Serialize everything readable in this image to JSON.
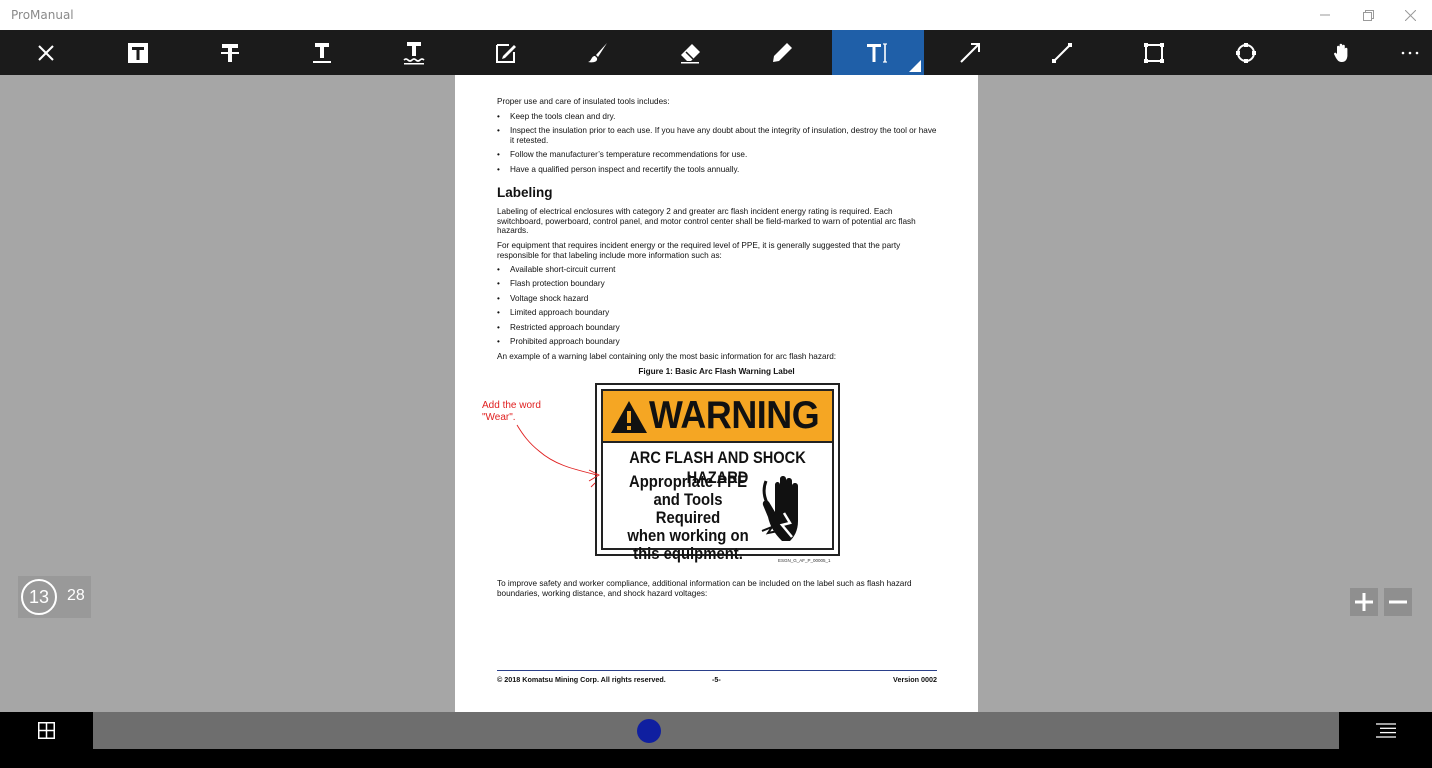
{
  "window": {
    "title": "ProManual",
    "controls": [
      "minimize-icon",
      "restore-icon",
      "close-icon"
    ]
  },
  "toolbar": {
    "tools": [
      {
        "name": "close-icon"
      },
      {
        "name": "highlight-text-icon"
      },
      {
        "name": "strikethrough-text-icon"
      },
      {
        "name": "underline-text-icon"
      },
      {
        "name": "squiggly-underline-icon"
      },
      {
        "name": "note-icon"
      },
      {
        "name": "brush-icon"
      },
      {
        "name": "eraser-icon"
      },
      {
        "name": "pencil-icon"
      },
      {
        "name": "text-box-icon",
        "active": true
      },
      {
        "name": "arrow-icon"
      },
      {
        "name": "line-icon"
      },
      {
        "name": "rectangle-icon"
      },
      {
        "name": "ellipse-icon"
      },
      {
        "name": "hand-pan-icon"
      },
      {
        "name": "more-icon"
      }
    ],
    "active_color": "#1f5fa8"
  },
  "document": {
    "intro": "Proper use and care of insulated tools includes:",
    "care_bullets": [
      "Keep the tools clean and dry.",
      "Inspect the insulation prior to each use. If you have any doubt about the integrity of insulation, destroy the tool or have it retested.",
      "Follow the manufacturer’s temperature recommendations for use.",
      "Have a qualified person inspect and recertify the tools annually."
    ],
    "heading": "Labeling",
    "para1": "Labeling of electrical enclosures with category 2 and greater arc flash incident energy rating is required. Each switchboard, powerboard, control panel, and motor control center shall be field-marked to warn of potential arc flash hazards.",
    "para2": "For equipment that requires incident energy or the required level of PPE, it is generally suggested that the party responsible for that labeling include more information such as:",
    "label_bullets": [
      "Available short-circuit current",
      "Flash protection boundary",
      "Voltage shock hazard",
      "Limited approach boundary",
      "Restricted approach boundary",
      "Prohibited approach boundary"
    ],
    "para3": "An example of a warning label containing only the most basic information for arc flash hazard:",
    "figure_caption": "Figure 1: Basic Arc Flash Warning Label",
    "sign": {
      "warning": "WARNING",
      "hazard": "ARC FLASH AND SHOCK HAZARD",
      "line1": "Appropriate PPE",
      "line2": "and Tools Required",
      "line3": "when working on",
      "line4": "this equipment.",
      "code": "ESGN_G_AF_P_00005_1"
    },
    "annotation": {
      "line1": "Add the word",
      "line2": "\"Wear\".",
      "color": "#e02020"
    },
    "para4": "To improve safety and worker compliance, additional information can be included on the label such as flash hazard boundaries, working distance, and shock hazard voltages:",
    "footer_left": "© 2018 Komatsu Mining Corp. All rights reserved.",
    "footer_mid": "-5-",
    "footer_right": "Version 0002"
  },
  "page_indicator": {
    "current": "13",
    "total": "28"
  },
  "zoom": {
    "in_icon": "plus-icon",
    "out_icon": "minus-icon"
  },
  "bottombar": {
    "grid_icon": "grid-view-icon",
    "list_icon": "table-of-contents-icon",
    "slider_color": "#0f1fa0",
    "slider_position": 0.46
  }
}
